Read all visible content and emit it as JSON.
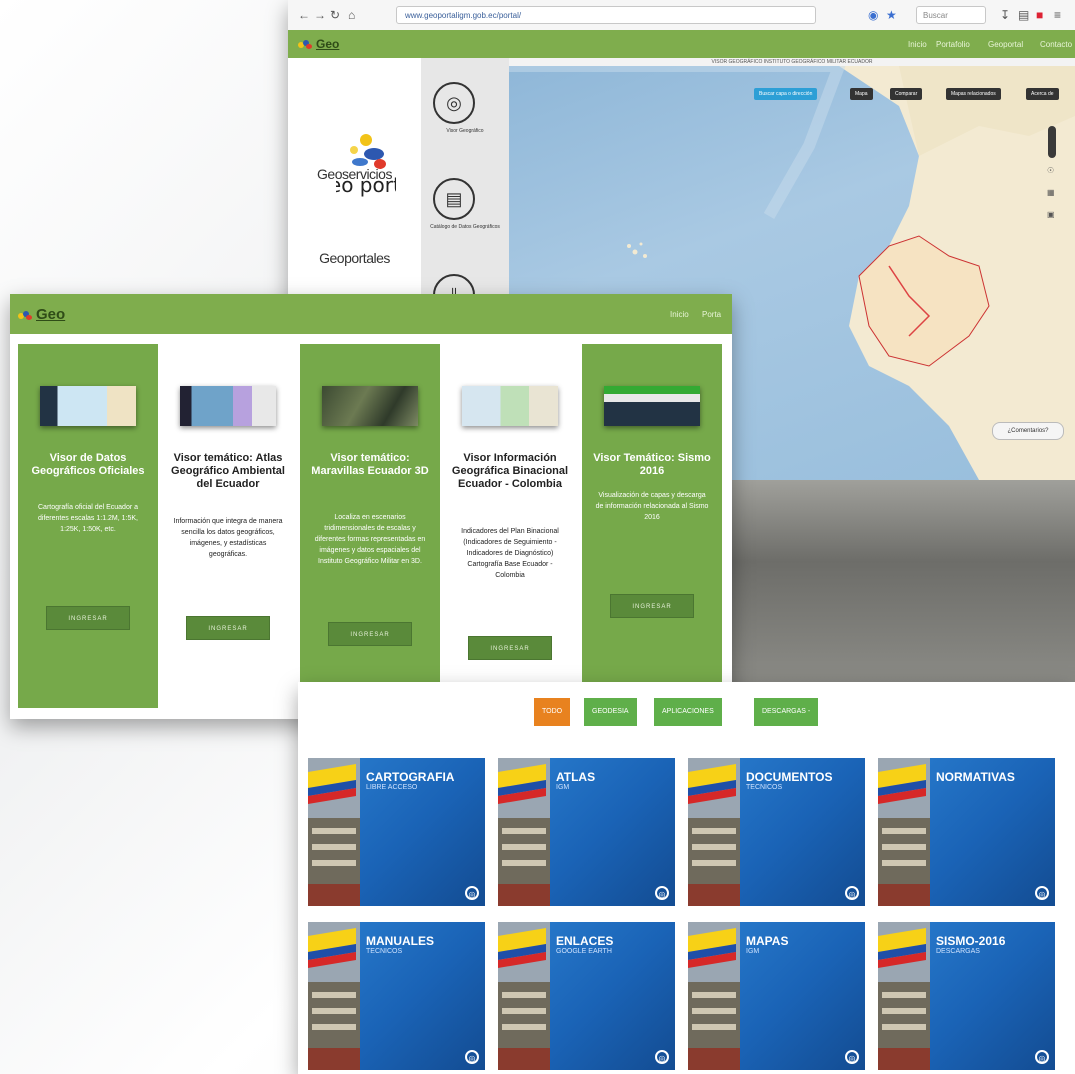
{
  "browser": {
    "url": "www.geoportaligm.gob.ec/portal/",
    "search_placeholder": "Buscar"
  },
  "geoportal_top": {
    "logo_text": "Geo",
    "nav": [
      "Inicio",
      "Portafolio",
      "Geoportal",
      "Contacto"
    ],
    "sidebar_logo_text": "Geo portal",
    "sidebar_items": [
      "Geoservicios",
      "Geoportales"
    ],
    "icon_items": [
      "Visor Geográfico",
      "Catálogo de Datos Geográficos"
    ],
    "map_title": "VISOR GEOGRÁFICO INSTITUTO GEOGRÁFICO MILITAR ECUADOR",
    "map_buttons": [
      "Buscar capa o dirección",
      "Mapa",
      "Comparar",
      "Mapas relacionados",
      "Acerca de"
    ],
    "comments_label": "¿Comentarios?"
  },
  "geoportal_cards": {
    "logo_text": "Geo",
    "nav": [
      "Inicio",
      "Porta"
    ],
    "cards": [
      {
        "title": "Visor de Datos Geográficos Oficiales",
        "desc": "Cartografía oficial del Ecuador a diferentes escalas 1:1.2M, 1:5K, 1:25K, 1:50K, etc.",
        "button": "INGRESAR",
        "style": "green"
      },
      {
        "title": "Visor temático: Atlas Geográfico Ambiental del Ecuador",
        "desc": "Información que integra de manera sencilla los datos geográficos, imágenes, y estadísticas geográficas.",
        "button": "INGRESAR",
        "style": "white"
      },
      {
        "title": "Visor temático: Maravillas Ecuador 3D",
        "desc": "Localiza en escenarios tridimensionales de escalas y diferentes formas representadas en imágenes y datos espaciales del Instituto Geográfico Militar en 3D.",
        "button": "INGRESAR",
        "style": "green"
      },
      {
        "title": "Visor Información Geográfica Binacional Ecuador - Colombia",
        "desc": "Indicadores del Plan Binacional (Indicadores de Seguimiento - Indicadores de Diagnóstico) Cartografía Base Ecuador - Colombia",
        "button": "INGRESAR",
        "style": "white"
      },
      {
        "title": "Visor Temático: Sismo 2016",
        "desc": "Visualización de capas y descarga de información relacionada al Sismo 2016",
        "button": "INGRESAR",
        "style": "green"
      }
    ]
  },
  "downloads": {
    "filters": [
      {
        "label": "TODO",
        "color": "#e8821f"
      },
      {
        "label": "GEODESIA",
        "color": "#5faf4a"
      },
      {
        "label": "APLICACIONES",
        "color": "#5faf4a"
      },
      {
        "label": "DESCARGAS -",
        "color": "#5faf4a"
      }
    ],
    "tiles": [
      {
        "title": "CARTOGRAFIA",
        "subtitle": "LIBRE ACCESO"
      },
      {
        "title": "ATLAS",
        "subtitle": "IGM"
      },
      {
        "title": "DOCUMENTOS",
        "subtitle": "TECNICOS"
      },
      {
        "title": "NORMATIVAS",
        "subtitle": ""
      },
      {
        "title": "MANUALES",
        "subtitle": "TECNICOS"
      },
      {
        "title": "ENLACES",
        "subtitle": "GOOGLE EARTH"
      },
      {
        "title": "MAPAS",
        "subtitle": "IGM"
      },
      {
        "title": "SISMO-2016",
        "subtitle": "DESCARGAS"
      }
    ]
  },
  "colors": {
    "header_green": "#7fad4d",
    "card_green": "#76a94a",
    "tile_blue": "#1a63b6",
    "accent_orange": "#e8821f"
  }
}
